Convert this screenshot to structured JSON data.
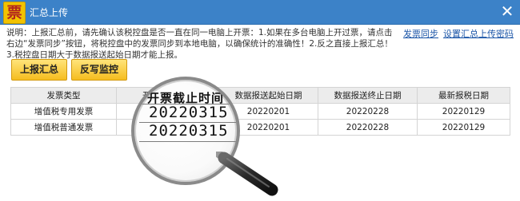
{
  "window": {
    "logo_char": "票",
    "title": "汇总上传",
    "close_glyph": "✕"
  },
  "notice": {
    "text": "说明：上报汇总前，请先确认该税控盘是否一直在同一电脑上开票：1.如果在多台电脑上开过票，请点击右边“发票同步”按钮，将税控盘中的发票同步到本地电脑，以确保统计的准确性！2.反之直接上报汇总！3.税控盘日期大于数据报送起始日期才能上报。"
  },
  "links": {
    "sync_invoice": "发票同步",
    "set_password": "设置汇总上传密码"
  },
  "toolbar": {
    "upload_summary": "上报汇总",
    "writeback_monitor": "反写监控"
  },
  "table": {
    "headers": [
      "发票类型",
      "开票截止时间",
      "数据报送起始日期",
      "数据报送终止日期",
      "最新报税日期"
    ],
    "rows": [
      [
        "增值税专用发票",
        "20220315",
        "20220201",
        "20220228",
        "20220129"
      ],
      [
        "增值税普通发票",
        "20220315",
        "20220201",
        "20220228",
        "20220129"
      ]
    ]
  },
  "magnifier": {
    "heading": "开票截止时间",
    "value1": "20220315",
    "value2": "20220315"
  },
  "colors": {
    "titlebar": "#3c82c8",
    "button": "#f5bd1f",
    "link": "#1c56a8"
  }
}
